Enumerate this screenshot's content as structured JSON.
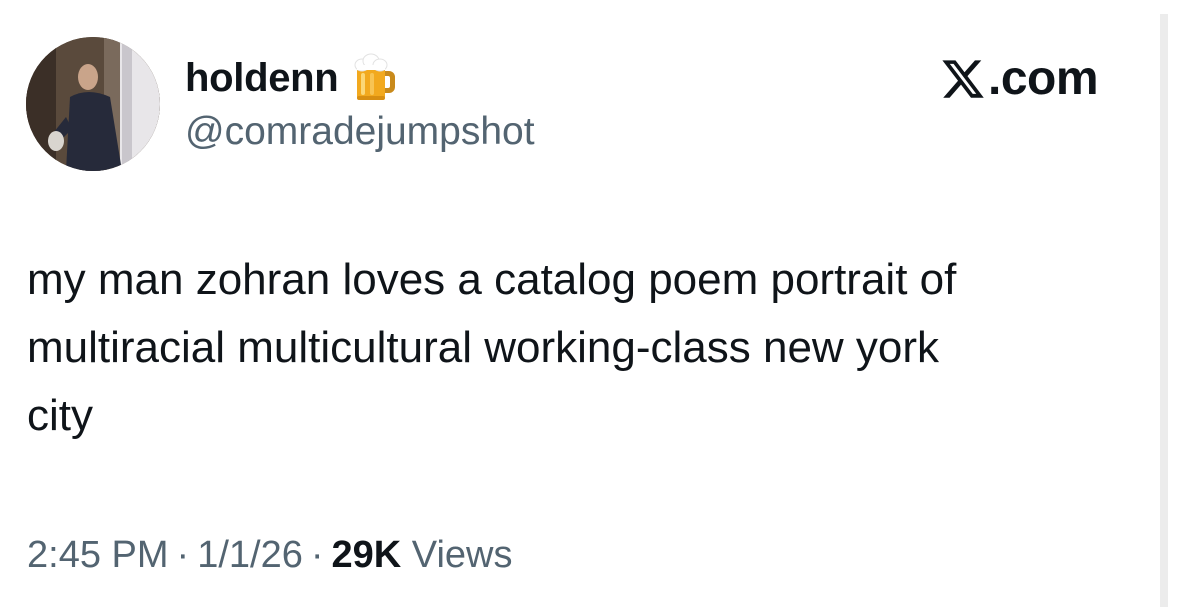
{
  "author": {
    "display_name": "holdenn",
    "name_emoji": "beer-mug-icon",
    "handle": "@comradejumpshot"
  },
  "brand": {
    "logo_icon": "x-logo-icon",
    "suffix": ".com"
  },
  "tweet": {
    "lines": [
      "my man zohran loves a catalog poem portrait of",
      "multiracial multicultural working-class new york",
      "city"
    ]
  },
  "meta": {
    "time": "2:45 PM",
    "separator": "·",
    "date": "1/1/26",
    "views_count": "29K",
    "views_label": "Views"
  },
  "colors": {
    "text_primary": "#0f1419",
    "text_secondary": "#536471",
    "background": "#ffffff"
  }
}
